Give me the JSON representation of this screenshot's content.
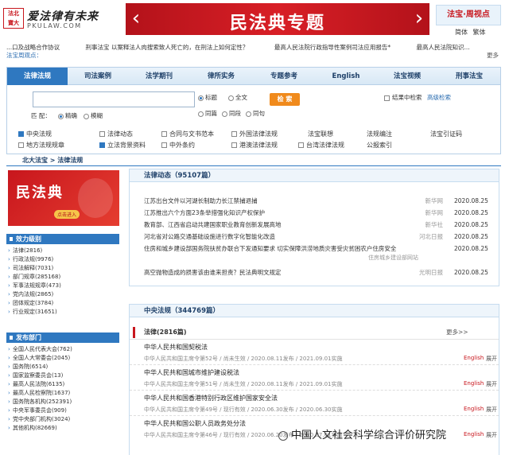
{
  "header": {
    "logo_text_1": "法北",
    "logo_text_2": "寶大",
    "logo_cn": "爱法律有未来",
    "logo_en": "PKULAW.COM",
    "banner_title": "民法典专题",
    "brand_text": "法宝·周视点",
    "lang_simplified": "简体",
    "lang_traditional": "繁体"
  },
  "ticker": [
    "...口及战略合作协议",
    "刑事法宝 以案释法人肉搜索致人死亡的，在刑法上如何定性？",
    "最高人民法院行政指导性案例司法应用报告*",
    "最高人民法院知识..."
  ],
  "notice": {
    "label": "法宝周观点：",
    "items": [],
    "more": "更多"
  },
  "nav_tabs": [
    "法律法规",
    "司法案例",
    "法学期刊",
    "律所实务",
    "专题参考",
    "English",
    "法宝视频",
    "刑事法宝"
  ],
  "search": {
    "opt_title": "标题",
    "opt_full": "全文",
    "opt_same_sentence": "同篇",
    "opt_same_para": "同段",
    "opt_same_line": "同句",
    "button": "检 索",
    "opt_within": "结果中检索",
    "advanced": "高级检索",
    "match_label": "匹 配：",
    "match_exact": "精确",
    "match_fuzzy": "模糊"
  },
  "categories_row1": [
    {
      "label": "中央法规",
      "checked": true
    },
    {
      "label": "法律动态",
      "checked": false
    },
    {
      "label": "合同与文书范本",
      "checked": false
    },
    {
      "label": "外国法律法规",
      "checked": false
    },
    {
      "label": "法宝联想",
      "checked": false
    },
    {
      "label": "法规编注",
      "checked": false
    },
    {
      "label": "法宝引证码",
      "checked": false
    }
  ],
  "categories_row2": [
    {
      "label": "地方法规规章",
      "checked": false
    },
    {
      "label": "立法背景资料",
      "checked": true
    },
    {
      "label": "中外条约",
      "checked": false
    },
    {
      "label": "港澳法律法规",
      "checked": false
    },
    {
      "label": "台湾法律法规",
      "checked": false
    },
    {
      "label": "公报索引",
      "checked": false
    }
  ],
  "breadcrumb": "北大法宝 > 法律法规",
  "promo": {
    "title": "民法典",
    "button": "点击进入"
  },
  "sidebar": {
    "section1_title": "效力级别",
    "section1_items": [
      "法律(2816)",
      "行政法规(9976)",
      "司法解释(7031)",
      "部门规章(285168)",
      "军事法规规章(473)",
      "党内法规(2865)",
      "团体规定(3784)",
      "行业规定(31651)"
    ],
    "section2_title": "发布部门",
    "section2_items": [
      "全国人民代表大会(762)",
      "全国人大常委会(2045)",
      "国务院(6514)",
      "国家监察委员会(13)",
      "最高人民法院(6135)",
      "最高人民检察院(1637)",
      "国务院各机构(252391)",
      "中央军事委员会(909)",
      "党中央部门机构(3024)",
      "其他机构(82669)"
    ]
  },
  "dynamics": {
    "title": "法律动态（95107篇）",
    "rows": [
      {
        "title": "江苏出台文件以河湖长制助力长江禁捕退捕",
        "source": "新华网",
        "date": "2020.08.25",
        "sub": ""
      },
      {
        "title": "江苏推出六个方面23条举措强化知识产权保护",
        "source": "新华网",
        "date": "2020.08.25",
        "sub": ""
      },
      {
        "title": "教育部、江西省启动共建国家职业教育创新发展高地",
        "source": "新华社",
        "date": "2020.08.25",
        "sub": ""
      },
      {
        "title": "河北省对公路交通基础设施进行数字化智能化改造",
        "source": "河北日报",
        "date": "2020.08.25",
        "sub": ""
      },
      {
        "title": "住房和城乡建设部国务院扶贫办联合下发通知要求 切实保障洪涝地质灾害受灾贫困农户住房安全",
        "source": "",
        "date": "2020.08.25",
        "sub": "住房城乡建设部网站"
      },
      {
        "title": "高空抛物造成的损害该由谁来担责？民法典明文规定",
        "source": "光明日报",
        "date": "2020.08.25",
        "sub": ""
      }
    ]
  },
  "central": {
    "title": "中央法规（344769篇）",
    "sub_title": "法律(2816篇)",
    "more": "更多>>",
    "items": [
      {
        "title": "中华人民共和国契税法",
        "meta": "中华人民共和国主席令第52号 / 尚未生效 / 2020.08.11发布 / 2021.09.01实施",
        "en": "English",
        "ex": "展开"
      },
      {
        "title": "中华人民共和国城市维护建设税法",
        "meta": "中华人民共和国主席令第51号 / 尚未生效 / 2020.08.11发布 / 2021.09.01实施",
        "en": "English",
        "ex": "展开"
      },
      {
        "title": "中华人民共和国香港特别行政区维护国家安全法",
        "meta": "中华人民共和国主席令第49号 / 现行有效 / 2020.06.30发布 / 2020.06.30实施",
        "en": "English",
        "ex": "展开"
      },
      {
        "title": "中华人民共和国公职人员政务处分法",
        "meta": "中华人民共和国主席令第46号 / 现行有效 / 2020.06.20发布 / 2020.07.01实施",
        "en": "English",
        "ex": "展开"
      }
    ]
  },
  "watermark": "中国人文社会科学综合评价研究院",
  "colors": {
    "brand_red": "#c8161d",
    "nav_blue": "#2f78c0",
    "search_orange": "#f08a1c"
  }
}
